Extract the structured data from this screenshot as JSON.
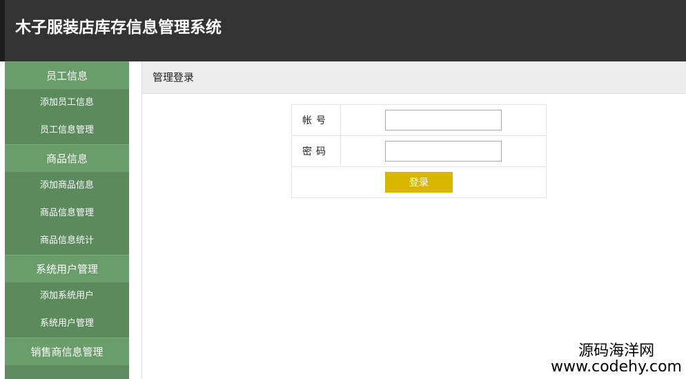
{
  "header": {
    "title": "木子服装店库存信息管理系统"
  },
  "sidebar": {
    "groups": [
      {
        "label": "员工信息",
        "items": [
          "添加员工信息",
          "员工信息管理"
        ]
      },
      {
        "label": "商品信息",
        "items": [
          "添加商品信息",
          "商品信息管理",
          "商品信息统计"
        ]
      },
      {
        "label": "系统用户管理",
        "items": [
          "添加系统用户",
          "系统用户管理"
        ]
      },
      {
        "label": "销售商信息管理",
        "items": []
      }
    ]
  },
  "main": {
    "breadcrumb": "管理登录",
    "login": {
      "account_label": "帐号",
      "account_value": "",
      "password_label": "密码",
      "password_value": "",
      "submit_label": "登录"
    }
  },
  "watermark": {
    "line1": "源码海洋网",
    "line2": "www.codehy.com"
  }
}
